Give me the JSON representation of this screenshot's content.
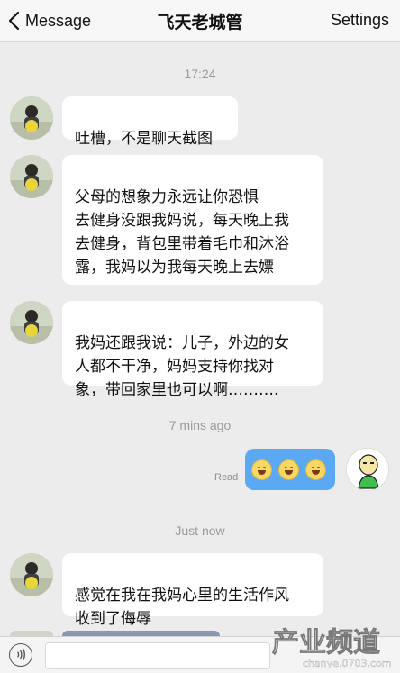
{
  "header": {
    "back_label": "Message",
    "title": "飞天老城管",
    "settings_label": "Settings"
  },
  "timestamps": [
    "17:24",
    "7 mins ago",
    "Just now"
  ],
  "messages": [
    {
      "from": "contact",
      "text": "吐槽，不是聊天截图"
    },
    {
      "from": "contact",
      "text": "父母的想象力永远让你恐惧\n去健身没跟我妈说，每天晚上我\n去健身，背包里带着毛巾和沐浴\n露，我妈以为我每天晚上去嫖",
      "emoji": [
        "smile-emoji",
        "smile-emoji",
        "smile-emoji"
      ]
    },
    {
      "from": "contact",
      "text": "我妈还跟我说：儿子，外边的女\n人都不干净，妈妈支持你找对\n象，带回家里也可以啊………."
    },
    {
      "from": "me",
      "status": "Read",
      "emoji": [
        "laugh-emoji",
        "laugh-emoji",
        "laugh-emoji"
      ]
    },
    {
      "from": "contact",
      "text": "感觉在我在我妈心里的生活作风\n收到了侮辱"
    }
  ],
  "watermark": {
    "brand": "产业频道",
    "url": "chanye.0703.com"
  },
  "colors": {
    "background": "#ececec",
    "outgoing_bubble": "#5aa9f2",
    "incoming_bubble": "#ffffff"
  }
}
